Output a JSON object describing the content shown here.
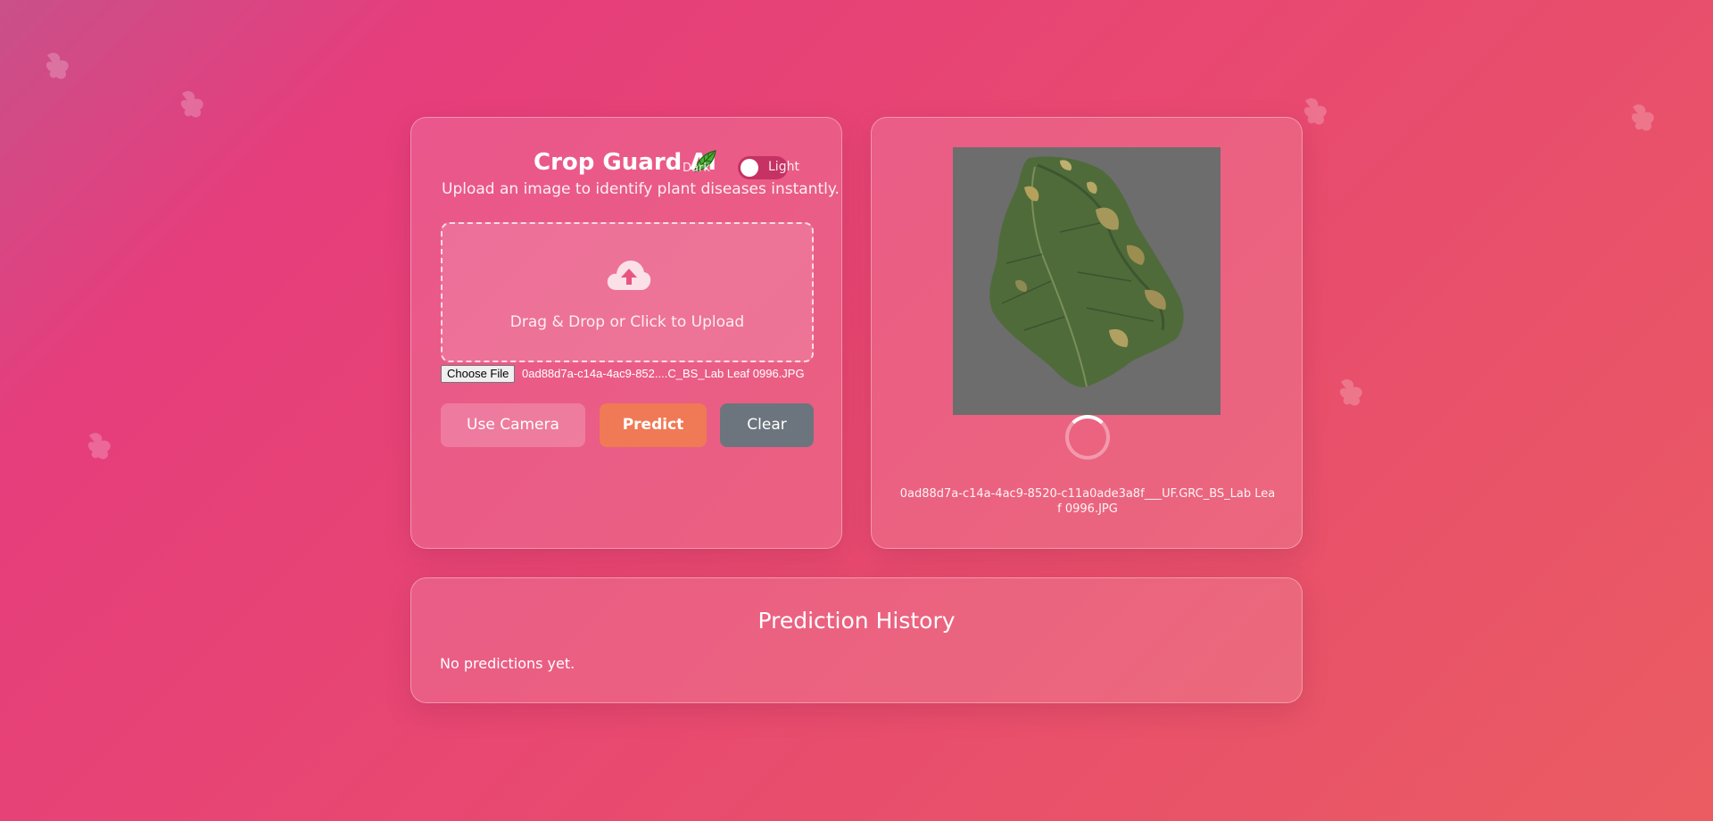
{
  "app": {
    "title": "Crop Guard AI",
    "subtitle": "Upload an image to identify plant diseases instantly."
  },
  "theme_toggle": {
    "dark_label": "Dark",
    "light_label": "Light",
    "state": "dark"
  },
  "upload": {
    "dropzone_text": "Drag & Drop or Click to Upload",
    "choose_file_label": "Choose File",
    "selected_file_display": "0ad88d7a-c14a-4ac9-852....C_BS_Lab Leaf 0996.JPG"
  },
  "actions": {
    "camera_label": "Use Camera",
    "predict_label": "Predict",
    "clear_label": "Clear"
  },
  "preview": {
    "file_name": "0ad88d7a-c14a-4ac9-8520-c11a0ade3a8f___UF.GRC_BS_Lab Leaf 0996.JPG",
    "loading": true
  },
  "history": {
    "title": "Prediction History",
    "empty_text": "No predictions yet."
  },
  "colors": {
    "predict_button": "#ef7a55",
    "clear_button": "#6c757d",
    "toggle_track": "#c53263"
  },
  "icons": {
    "upload": "cloud-upload-icon",
    "title_emoji": "leaf-icon",
    "background": "plant-sprout-icon"
  }
}
